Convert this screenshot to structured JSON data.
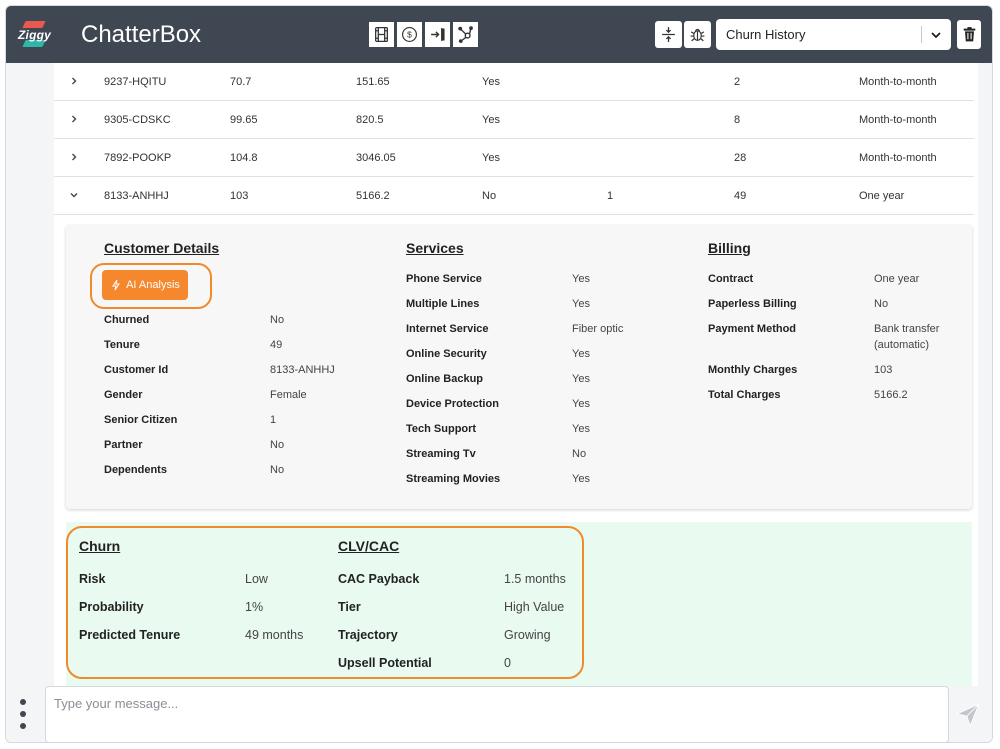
{
  "app": {
    "logo_text": "Ziggy",
    "title": "ChatterBox"
  },
  "toolbar": {
    "icons": [
      "film-icon",
      "dollar-coin-icon",
      "sidebar-exit-icon",
      "hub-icon"
    ],
    "right_icons": [
      "collapse-vertical-icon",
      "bug-icon"
    ],
    "history_select": {
      "selected": "Churn History"
    },
    "delete_icon": "trash-icon"
  },
  "table": {
    "rows": [
      {
        "expanded": false,
        "id": "9237-HQITU",
        "monthly": "70.7",
        "total": "151.65",
        "flag": "Yes",
        "extra": "",
        "tenure": "2",
        "contract": "Month-to-month"
      },
      {
        "expanded": false,
        "id": "9305-CDSKC",
        "monthly": "99.65",
        "total": "820.5",
        "flag": "Yes",
        "extra": "",
        "tenure": "8",
        "contract": "Month-to-month"
      },
      {
        "expanded": false,
        "id": "7892-POOKP",
        "monthly": "104.8",
        "total": "3046.05",
        "flag": "Yes",
        "extra": "",
        "tenure": "28",
        "contract": "Month-to-month"
      },
      {
        "expanded": true,
        "id": "8133-ANHHJ",
        "monthly": "103",
        "total": "5166.2",
        "flag": "No",
        "extra": "1",
        "tenure": "49",
        "contract": "One year"
      }
    ]
  },
  "details": {
    "customer": {
      "title": "Customer Details",
      "ai_button": "AI Analysis",
      "fields": [
        {
          "label": "Churned",
          "value": "No"
        },
        {
          "label": "Tenure",
          "value": "49"
        },
        {
          "label": "Customer Id",
          "value": "8133-ANHHJ"
        },
        {
          "label": "Gender",
          "value": "Female"
        },
        {
          "label": "Senior Citizen",
          "value": "1"
        },
        {
          "label": "Partner",
          "value": "No"
        },
        {
          "label": "Dependents",
          "value": "No"
        }
      ]
    },
    "services": {
      "title": "Services",
      "fields": [
        {
          "label": "Phone Service",
          "value": "Yes"
        },
        {
          "label": "Multiple Lines",
          "value": "Yes"
        },
        {
          "label": "Internet Service",
          "value": "Fiber optic"
        },
        {
          "label": "Online Security",
          "value": "Yes"
        },
        {
          "label": "Online Backup",
          "value": "Yes"
        },
        {
          "label": "Device Protection",
          "value": "Yes"
        },
        {
          "label": "Tech Support",
          "value": "Yes"
        },
        {
          "label": "Streaming Tv",
          "value": "No"
        },
        {
          "label": "Streaming Movies",
          "value": "Yes"
        }
      ]
    },
    "billing": {
      "title": "Billing",
      "fields": [
        {
          "label": "Contract",
          "value": "One year"
        },
        {
          "label": "Paperless Billing",
          "value": "No"
        },
        {
          "label": "Payment Method",
          "value": "Bank transfer",
          "value2": "(automatic)"
        },
        {
          "label": "Monthly Charges",
          "value": "103"
        },
        {
          "label": "Total Charges",
          "value": "5166.2"
        }
      ]
    }
  },
  "churn": {
    "title": "Churn",
    "fields": [
      {
        "label": "Risk",
        "value": "Low"
      },
      {
        "label": "Probability",
        "value": "1%"
      },
      {
        "label": "Predicted Tenure",
        "value": "49 months"
      }
    ]
  },
  "clv": {
    "title": "CLV/CAC",
    "fields": [
      {
        "label": "CAC Payback",
        "value": "1.5 months"
      },
      {
        "label": "Tier",
        "value": "High Value"
      },
      {
        "label": "Trajectory",
        "value": "Growing"
      },
      {
        "label": "Upsell Potential",
        "value": "0"
      }
    ]
  },
  "chat": {
    "placeholder": "Type your message..."
  },
  "colors": {
    "header": "#3f4753",
    "accent": "#f5872c",
    "churn_bg": "#e9faf0"
  }
}
